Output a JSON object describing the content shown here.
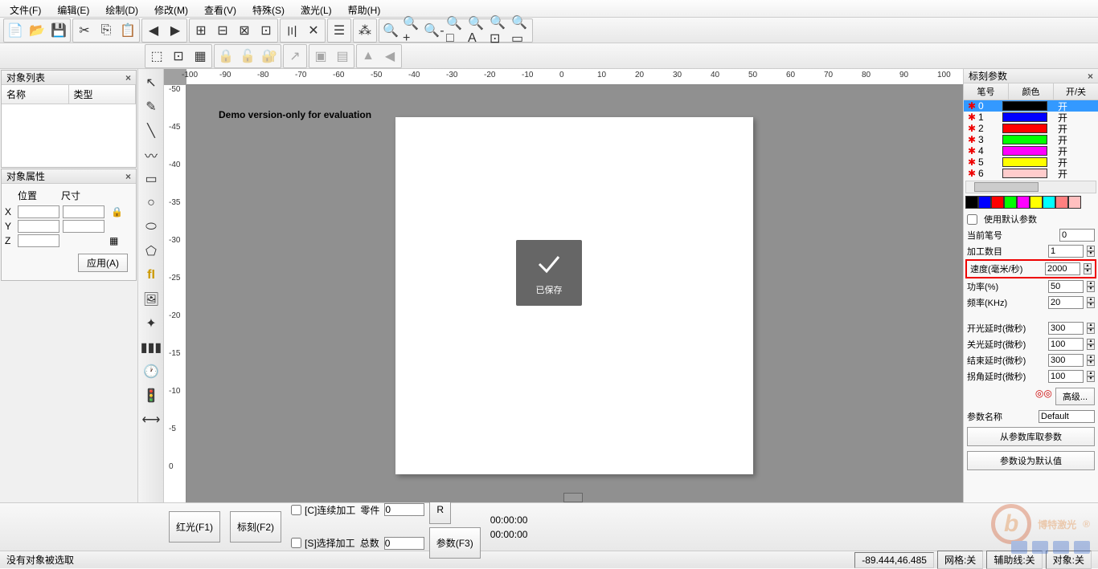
{
  "menu": [
    "文件(F)",
    "编辑(E)",
    "绘制(D)",
    "修改(M)",
    "查看(V)",
    "特殊(S)",
    "激光(L)",
    "帮助(H)"
  ],
  "panels": {
    "object_list": {
      "title": "对象列表",
      "col1": "名称",
      "col2": "类型"
    },
    "object_prop": {
      "title": "对象属性",
      "position": "位置",
      "size": "尺寸",
      "x": "X",
      "y": "Y",
      "z": "Z",
      "apply": "应用(A)"
    },
    "mark_param": {
      "title": "标刻参数"
    }
  },
  "canvas": {
    "demo_text": "Demo version-only for evaluation",
    "ruler_h": [
      "-100",
      "-90",
      "-80",
      "-70",
      "-60",
      "-50",
      "-40",
      "-30",
      "-20",
      "-10",
      "0",
      "10",
      "20",
      "30",
      "40",
      "50",
      "60",
      "70",
      "80",
      "90",
      "100"
    ],
    "ruler_v": [
      "-50",
      "-45",
      "-40",
      "-35",
      "-30",
      "-25",
      "-20",
      "-15",
      "-10",
      "-5",
      "0"
    ]
  },
  "pens": {
    "hdr": [
      "笔号",
      "颜色",
      "开/关"
    ],
    "rows": [
      {
        "n": "0",
        "color": "#000000",
        "on": "开",
        "sel": true
      },
      {
        "n": "1",
        "color": "#0000ff",
        "on": "开"
      },
      {
        "n": "2",
        "color": "#ff0000",
        "on": "开"
      },
      {
        "n": "3",
        "color": "#00ff00",
        "on": "开"
      },
      {
        "n": "4",
        "color": "#ff00ff",
        "on": "开"
      },
      {
        "n": "5",
        "color": "#ffff00",
        "on": "开"
      },
      {
        "n": "6",
        "color": "#ffcccc",
        "on": "开"
      }
    ]
  },
  "colorbar": [
    "#000",
    "#0000ff",
    "#ff0000",
    "#00ff00",
    "#ff00ff",
    "#ffff00",
    "#00ffff",
    "#ff8080",
    "#ffc0c0"
  ],
  "params": {
    "use_default": "使用默认参数",
    "current_pen": {
      "label": "当前笔号",
      "val": "0"
    },
    "work_count": {
      "label": "加工数目",
      "val": "1"
    },
    "speed": {
      "label": "速度(毫米/秒)",
      "val": "2000"
    },
    "power": {
      "label": "功率(%)",
      "val": "50"
    },
    "freq": {
      "label": "频率(KHz)",
      "val": "20"
    },
    "on_delay": {
      "label": "开光延时(微秒)",
      "val": "300"
    },
    "off_delay": {
      "label": "关光延时(微秒)",
      "val": "100"
    },
    "end_delay": {
      "label": "结束延时(微秒)",
      "val": "300"
    },
    "corner_delay": {
      "label": "拐角延时(微秒)",
      "val": "100"
    },
    "advanced": "高级...",
    "param_name": {
      "label": "参数名称",
      "val": "Default"
    },
    "load_from_lib": "从参数库取参数",
    "set_as_default": "参数设为默认值"
  },
  "bottom": {
    "red": "红光(F1)",
    "mark": "标刻(F2)",
    "continuous": "[C]连续加工",
    "select": "[S]选择加工",
    "parts": "零件",
    "total": "总数",
    "parts_val": "0",
    "total_val": "0",
    "r_btn": "R",
    "time1": "00:00:00",
    "time2": "00:00:00",
    "param_btn": "参数(F3)"
  },
  "status": {
    "left": "没有对象被选取",
    "coord": "-89.444,46.485",
    "grid": "网格:关",
    "guide": "辅助线:关",
    "object": "对象:关"
  },
  "toast": "已保存",
  "watermark": {
    "text": "博特激光",
    "r": "®"
  }
}
